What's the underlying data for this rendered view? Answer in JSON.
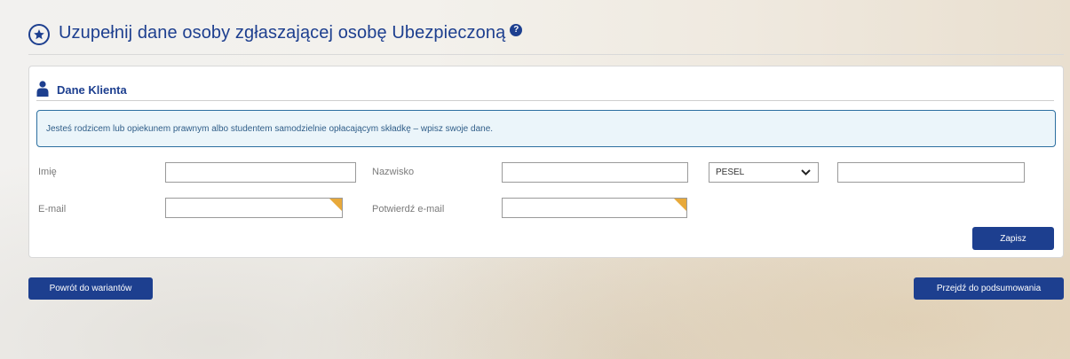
{
  "header": {
    "title": "Uzupełnij dane osoby zgłaszającej osobę Ubezpieczoną",
    "help_icon_glyph": "?"
  },
  "card": {
    "title": "Dane Klienta",
    "info_text": "Jesteś rodzicem lub opiekunem prawnym albo studentem samodzielnie opłacającym składkę – wpisz swoje dane."
  },
  "form": {
    "first_name_label": "Imię",
    "first_name_value": "",
    "last_name_label": "Nazwisko",
    "last_name_value": "",
    "id_type_selected": "PESEL",
    "id_value": "",
    "email_label": "E-mail",
    "email_value": "",
    "confirm_email_label": "Potwierdź e-mail",
    "confirm_email_value": "",
    "save_label": "Zapisz"
  },
  "nav": {
    "back_label": "Powrót do wariantów",
    "next_label": "Przejdź do podsumowania"
  },
  "colors": {
    "primary": "#1d3f8f",
    "required_marker": "#e8a93a",
    "info_bg": "#ebf5fa",
    "info_border": "#2c6fa0"
  },
  "icons": [
    "star-circle-icon",
    "help-icon",
    "person-icon",
    "chevron-down-icon"
  ]
}
